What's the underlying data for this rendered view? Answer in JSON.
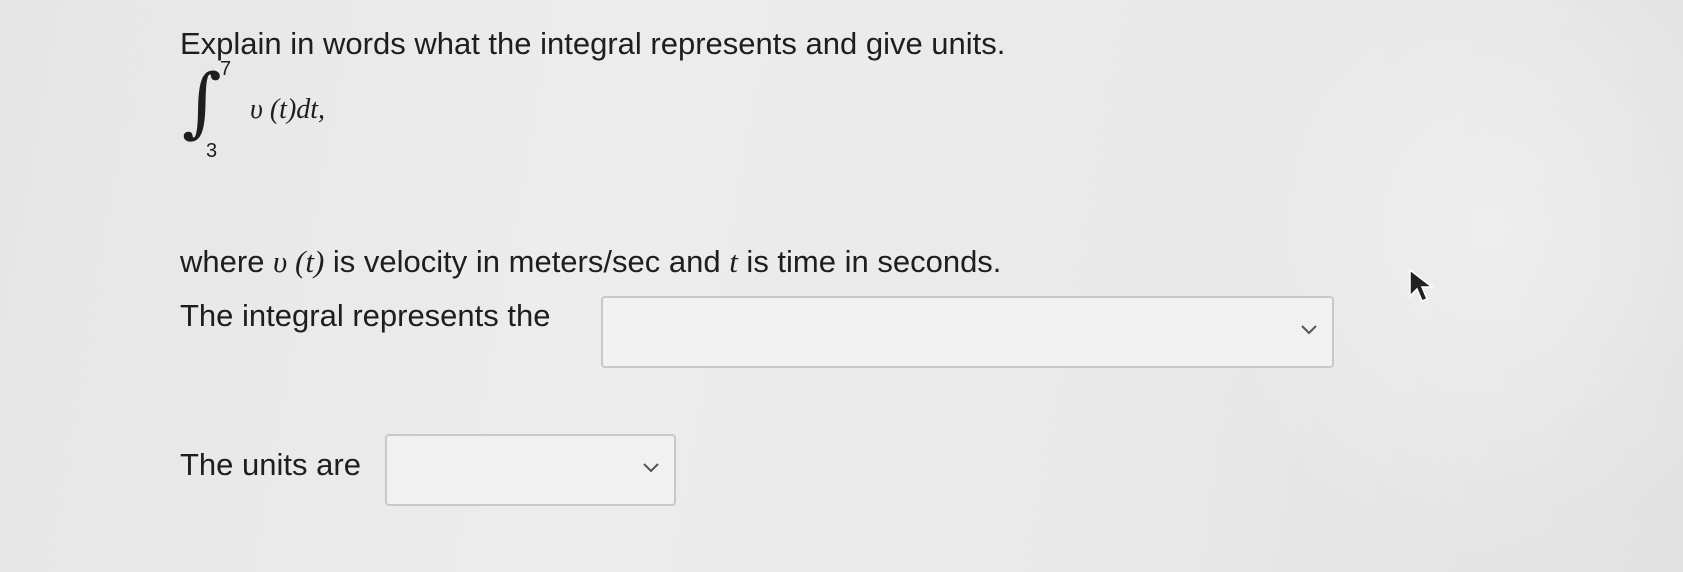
{
  "question": {
    "prompt": "Explain in words what the integral represents and give units."
  },
  "integral": {
    "sign": "∫",
    "upper_limit": "7",
    "lower_limit": "3",
    "integrand": "υ (t)dt,"
  },
  "where_line": {
    "part1": "where ",
    "var_v": "υ (t)",
    "part2": " is velocity in meters/sec and ",
    "var_t": "t",
    "part3": " is time in seconds."
  },
  "fields": {
    "represents_label": "The integral represents the",
    "represents_value": "",
    "units_label": "The units are",
    "units_value": ""
  },
  "icons": {
    "dropdown_chevron": "chevron-down-icon",
    "pointer": "mouse-cursor-icon"
  }
}
